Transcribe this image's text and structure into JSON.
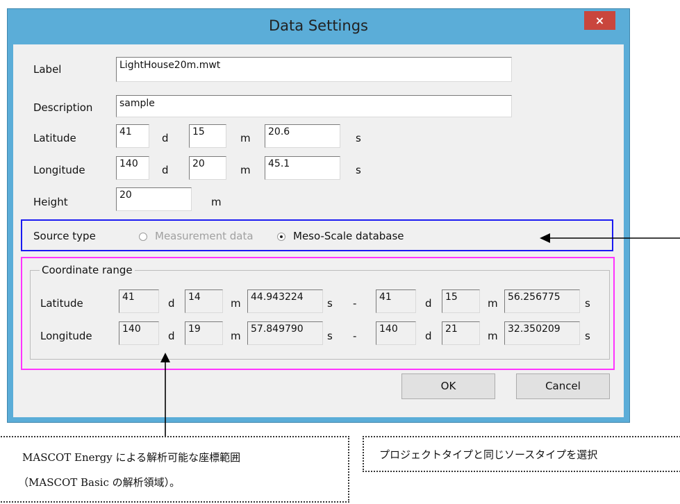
{
  "dialog": {
    "title": "Data Settings",
    "close_glyph": "×",
    "label_label": "Label",
    "label_value": "LightHouse20m.mwt",
    "description_label": "Description",
    "description_value": "sample",
    "latitude_label": "Latitude",
    "latitude": {
      "d": "41",
      "m": "15",
      "s": "20.6"
    },
    "longitude_label": "Longitude",
    "longitude": {
      "d": "140",
      "m": "20",
      "s": "45.1"
    },
    "height_label": "Height",
    "height_value": "20",
    "units": {
      "d": "d",
      "m": "m",
      "s": "s"
    },
    "source_type_label": "Source type",
    "source_options": [
      "Measurement data",
      "Meso-Scale database"
    ],
    "source_selected": "Meso-Scale database",
    "coord_group_title": "Coordinate range",
    "coord_lat_label": "Latitude",
    "coord_lon_label": "Longitude",
    "coord_range_sep": "-",
    "coord_lat_from": {
      "d": "41",
      "m": "14",
      "s": "44.943224"
    },
    "coord_lat_to": {
      "d": "41",
      "m": "15",
      "s": "56.256775"
    },
    "coord_lon_from": {
      "d": "140",
      "m": "19",
      "s": "57.849790"
    },
    "coord_lon_to": {
      "d": "140",
      "m": "21",
      "s": "32.350209"
    },
    "ok_label": "OK",
    "cancel_label": "Cancel"
  },
  "annotations": {
    "coord_note_line1": "MASCOT Energy による解析可能な座標範囲",
    "coord_note_line2": "（MASCOT Basic の解析領域）。",
    "source_note": "プロジェクトタイプと同じソースタイプを選択"
  },
  "colors": {
    "title_bar": "#5badd8",
    "close_button": "#c9463d",
    "client_bg": "#f0f0f0",
    "source_highlight": "#1a1af2",
    "coord_highlight": "#ff33ff"
  },
  "icons": [
    "close-icon",
    "radio-unchecked-icon",
    "radio-checked-icon",
    "arrow-up-icon",
    "arrow-left-icon"
  ]
}
